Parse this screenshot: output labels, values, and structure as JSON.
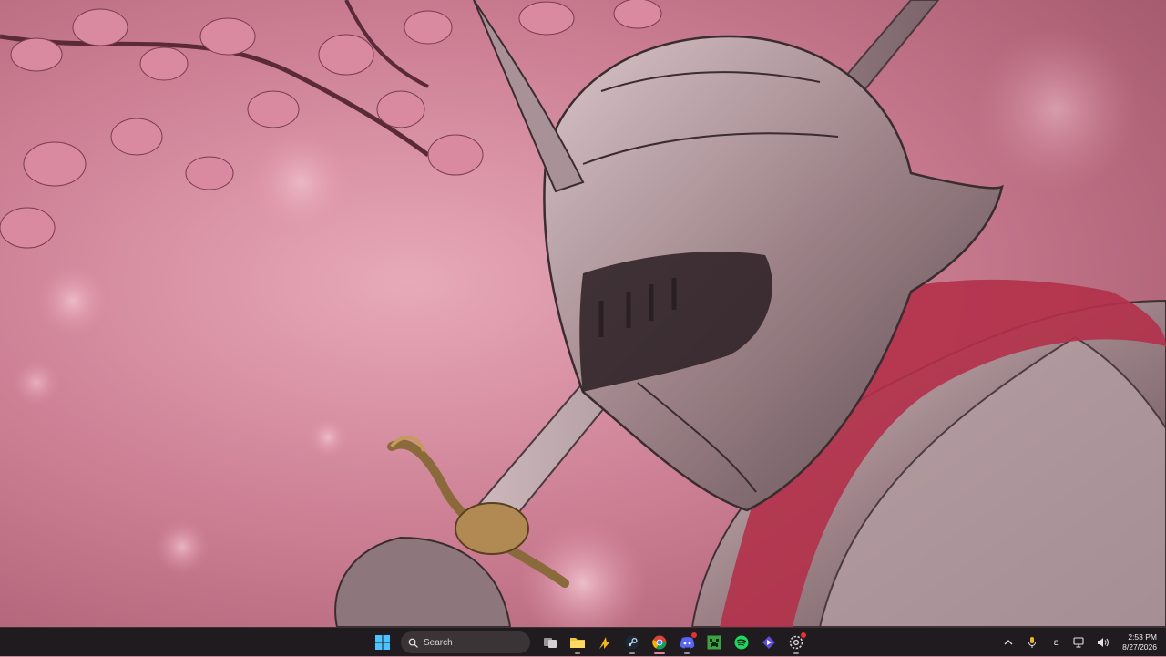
{
  "taskbar": {
    "search_placeholder": "Search",
    "pinned_apps": [
      {
        "name": "start-button",
        "icon": "windows-logo-icon"
      },
      {
        "name": "task-view-button",
        "icon": "task-view-icon"
      },
      {
        "name": "file-explorer-button",
        "icon": "folder-icon"
      },
      {
        "name": "app-button",
        "icon": "lightning-icon"
      },
      {
        "name": "steam-button",
        "icon": "steam-icon"
      },
      {
        "name": "chrome-button",
        "icon": "chrome-icon",
        "active": true
      },
      {
        "name": "discord-button",
        "icon": "discord-icon"
      },
      {
        "name": "minecraft-button",
        "icon": "minecraft-icon"
      },
      {
        "name": "spotify-button",
        "icon": "spotify-icon"
      },
      {
        "name": "app-diamond-button",
        "icon": "diamond-icon"
      },
      {
        "name": "settings-button",
        "icon": "gear-icon"
      }
    ],
    "tray": {
      "overflow_icon": "chevron-up-icon",
      "mic_icon": "microphone-icon",
      "language_label": "ε",
      "network_icon": "network-icon",
      "volume_icon": "speaker-icon"
    },
    "clock": {
      "time": "2:53 PM",
      "date": "8/27/2026"
    }
  },
  "colors": {
    "taskbar_bg": "#1f1b1e",
    "wallpaper_pink": "#d98da0",
    "accent": "#d58aa0"
  }
}
